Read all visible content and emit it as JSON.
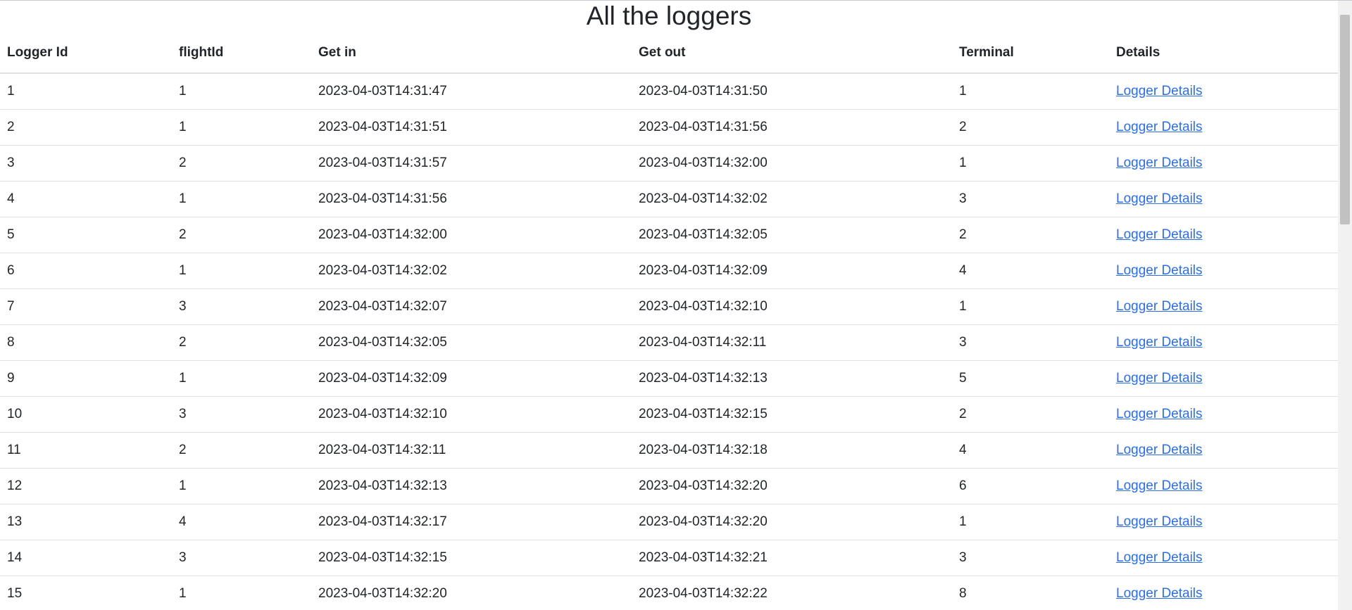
{
  "page": {
    "title": "All the loggers"
  },
  "table": {
    "headers": [
      "Logger Id",
      "flightId",
      "Get in",
      "Get out",
      "Terminal",
      "Details"
    ],
    "rows": [
      {
        "logger_id": "1",
        "flight_id": "1",
        "get_in": "2023-04-03T14:31:47",
        "get_out": "2023-04-03T14:31:50",
        "terminal": "1",
        "details": "Logger Details"
      },
      {
        "logger_id": "2",
        "flight_id": "1",
        "get_in": "2023-04-03T14:31:51",
        "get_out": "2023-04-03T14:31:56",
        "terminal": "2",
        "details": "Logger Details"
      },
      {
        "logger_id": "3",
        "flight_id": "2",
        "get_in": "2023-04-03T14:31:57",
        "get_out": "2023-04-03T14:32:00",
        "terminal": "1",
        "details": "Logger Details"
      },
      {
        "logger_id": "4",
        "flight_id": "1",
        "get_in": "2023-04-03T14:31:56",
        "get_out": "2023-04-03T14:32:02",
        "terminal": "3",
        "details": "Logger Details"
      },
      {
        "logger_id": "5",
        "flight_id": "2",
        "get_in": "2023-04-03T14:32:00",
        "get_out": "2023-04-03T14:32:05",
        "terminal": "2",
        "details": "Logger Details"
      },
      {
        "logger_id": "6",
        "flight_id": "1",
        "get_in": "2023-04-03T14:32:02",
        "get_out": "2023-04-03T14:32:09",
        "terminal": "4",
        "details": "Logger Details"
      },
      {
        "logger_id": "7",
        "flight_id": "3",
        "get_in": "2023-04-03T14:32:07",
        "get_out": "2023-04-03T14:32:10",
        "terminal": "1",
        "details": "Logger Details"
      },
      {
        "logger_id": "8",
        "flight_id": "2",
        "get_in": "2023-04-03T14:32:05",
        "get_out": "2023-04-03T14:32:11",
        "terminal": "3",
        "details": "Logger Details"
      },
      {
        "logger_id": "9",
        "flight_id": "1",
        "get_in": "2023-04-03T14:32:09",
        "get_out": "2023-04-03T14:32:13",
        "terminal": "5",
        "details": "Logger Details"
      },
      {
        "logger_id": "10",
        "flight_id": "3",
        "get_in": "2023-04-03T14:32:10",
        "get_out": "2023-04-03T14:32:15",
        "terminal": "2",
        "details": "Logger Details"
      },
      {
        "logger_id": "11",
        "flight_id": "2",
        "get_in": "2023-04-03T14:32:11",
        "get_out": "2023-04-03T14:32:18",
        "terminal": "4",
        "details": "Logger Details"
      },
      {
        "logger_id": "12",
        "flight_id": "1",
        "get_in": "2023-04-03T14:32:13",
        "get_out": "2023-04-03T14:32:20",
        "terminal": "6",
        "details": "Logger Details"
      },
      {
        "logger_id": "13",
        "flight_id": "4",
        "get_in": "2023-04-03T14:32:17",
        "get_out": "2023-04-03T14:32:20",
        "terminal": "1",
        "details": "Logger Details"
      },
      {
        "logger_id": "14",
        "flight_id": "3",
        "get_in": "2023-04-03T14:32:15",
        "get_out": "2023-04-03T14:32:21",
        "terminal": "3",
        "details": "Logger Details"
      },
      {
        "logger_id": "15",
        "flight_id": "1",
        "get_in": "2023-04-03T14:32:20",
        "get_out": "2023-04-03T14:32:22",
        "terminal": "8",
        "details": "Logger Details"
      }
    ]
  },
  "colors": {
    "link": "#2b6fe8",
    "text": "#212529",
    "border": "#dee2e6"
  }
}
